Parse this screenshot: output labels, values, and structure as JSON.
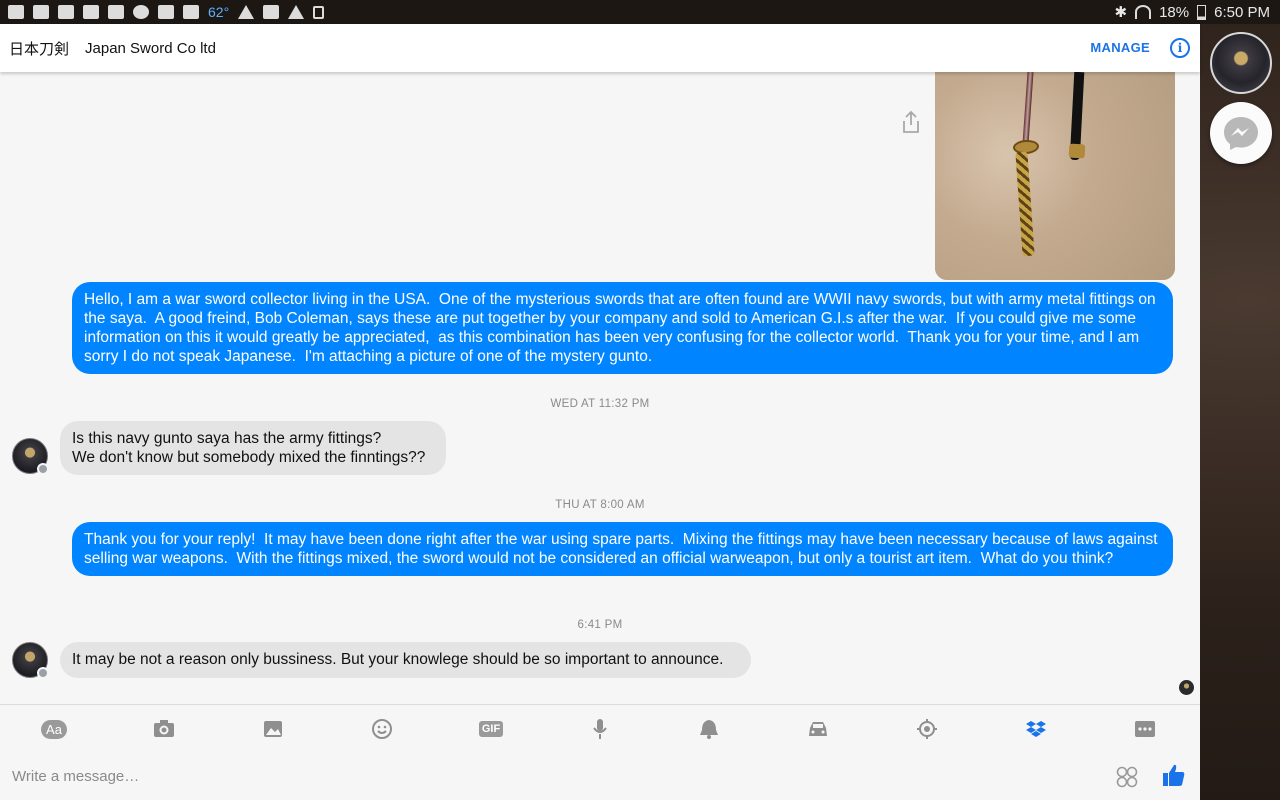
{
  "status_bar": {
    "temperature": "62°",
    "battery": "18%",
    "time": "6:50 PM"
  },
  "header": {
    "title_jp": "日本刀剣",
    "title": "Japan Sword Co ltd",
    "manage_label": "MANAGE"
  },
  "messages": [
    {
      "direction": "out",
      "text": "Hello, I am a war sword collector living in the USA.  One of the mysterious swords that are often found are WWII navy swords, but with army metal fittings on the saya.  A good freind, Bob Coleman, says these are put together by your company and sold to American G.I.s after the war.  If you could give me some information on this it would greatly be appreciated,  as this combination has been very confusing for the collector world.  Thank you for your time, and I am sorry I do not speak Japanese.  I'm attaching a picture of one of the mystery gunto."
    },
    {
      "timestamp": "WED AT 11:32 PM"
    },
    {
      "direction": "in",
      "text": "Is this navy gunto saya has the army fittings?\nWe don't know but somebody mixed the finntings??"
    },
    {
      "timestamp": "THU AT 8:00 AM"
    },
    {
      "direction": "out",
      "text": "Thank you for your reply!  It may have been done right after the war using spare parts.  Mixing the fittings may have been necessary because of laws against selling war weapons.  With the fittings mixed, the sword would not be considered an official warweapon, but only a tourist art item.  What do you think?"
    },
    {
      "timestamp": "6:41 PM"
    },
    {
      "direction": "in",
      "text": "It may be not a reason only bussiness. But your knowlege should be so important to announce."
    }
  ],
  "toolbar": {
    "text_tool": "Aa",
    "gif_tool": "GIF",
    "icons": [
      "text-icon",
      "camera-icon",
      "gallery-icon",
      "emoji-icon",
      "gif-icon",
      "microphone-icon",
      "bell-icon",
      "car-icon",
      "location-icon",
      "dropbox-icon",
      "more-icon"
    ],
    "active_color": "#1a73e8"
  },
  "composer": {
    "placeholder": "Write a message…"
  },
  "colors": {
    "outgoing_bubble": "#0084ff",
    "incoming_bubble": "#e4e4e4",
    "accent": "#1a73e8"
  }
}
